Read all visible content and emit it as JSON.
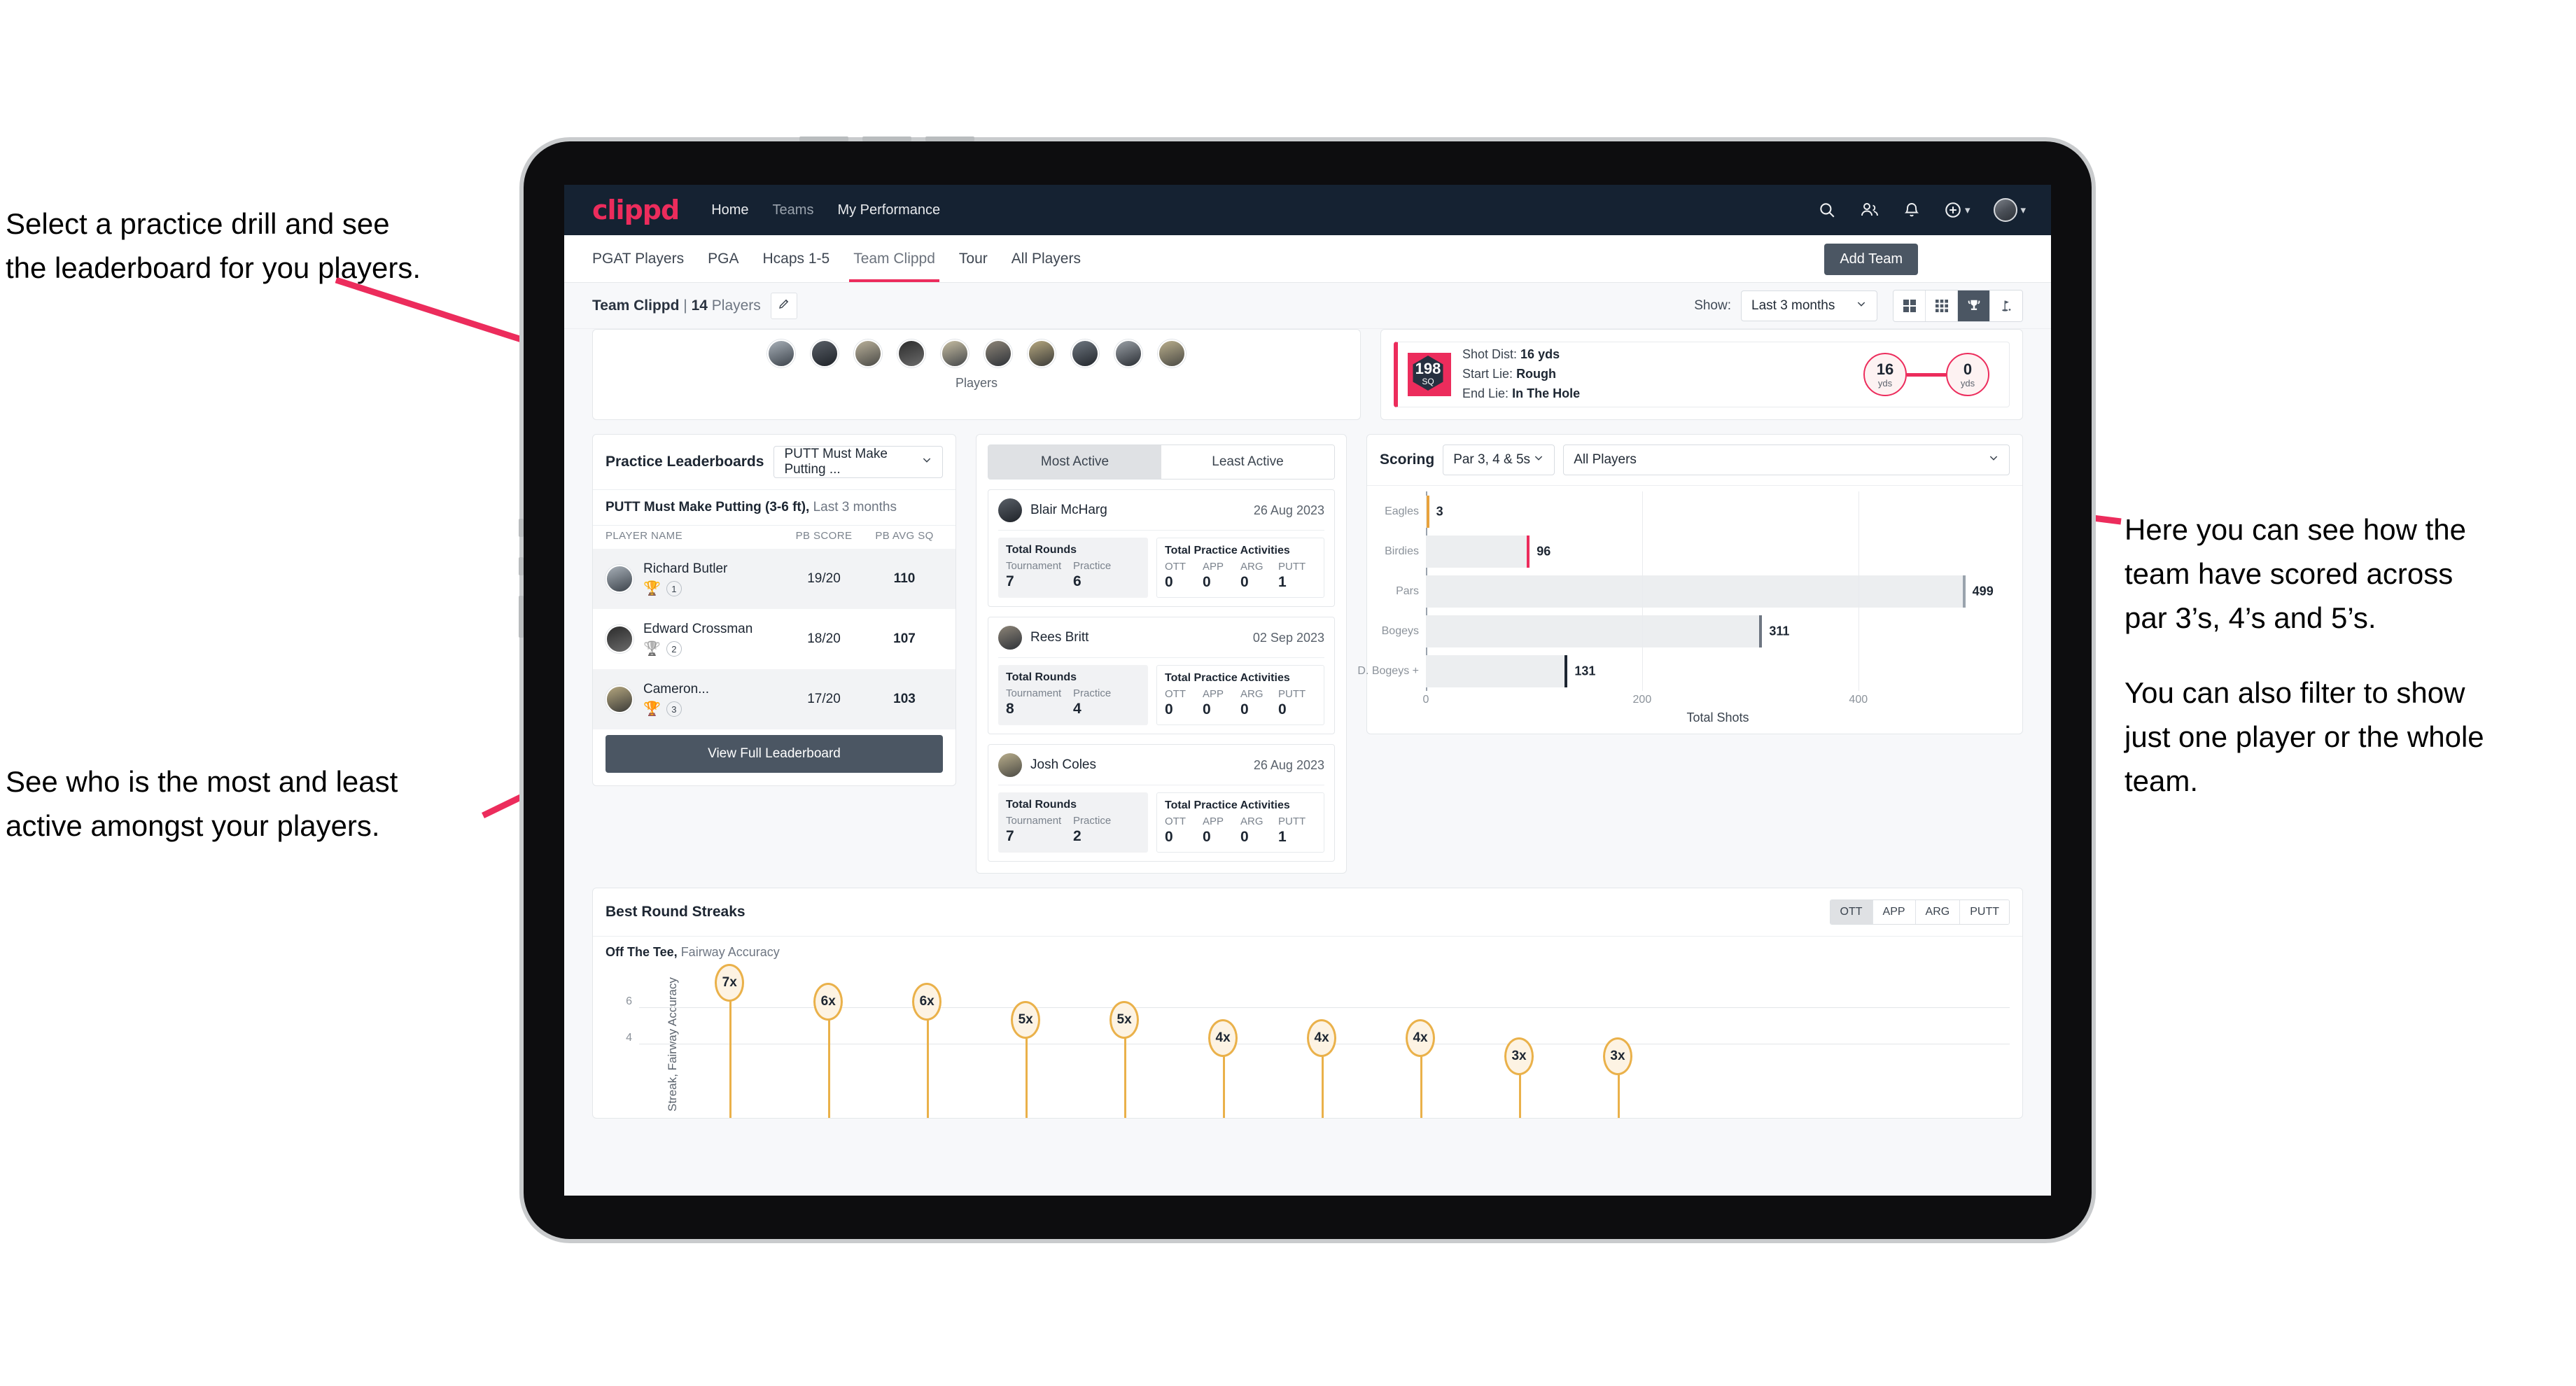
{
  "annotations": {
    "top_left": [
      "Select a practice drill and see",
      "the leaderboard for you players."
    ],
    "bottom_left": [
      "See who is the most and least",
      "active amongst your players."
    ],
    "right_p1": [
      "Here you can see how the",
      "team have scored across",
      "par 3’s, 4’s and 5’s."
    ],
    "right_p2": [
      "You can also filter to show",
      "just one player or the whole",
      "team."
    ]
  },
  "app": {
    "logo": "clippd",
    "nav": [
      {
        "label": "Home",
        "active": true
      },
      {
        "label": "Teams",
        "active": false
      },
      {
        "label": "My Performance",
        "active": true
      }
    ],
    "icons": [
      "search-icon",
      "people-icon",
      "bell-icon",
      "plus-circle-icon",
      "avatar"
    ],
    "tabs": [
      {
        "label": "PGAT Players",
        "active": false
      },
      {
        "label": "PGA",
        "active": false
      },
      {
        "label": "Hcaps 1-5",
        "active": false
      },
      {
        "label": "Team Clippd",
        "active": true
      },
      {
        "label": "Tour",
        "active": false
      },
      {
        "label": "All Players",
        "active": false
      }
    ],
    "add_team_label": "Add Team"
  },
  "subbar": {
    "team_name": "Team Clippd",
    "separator": " | ",
    "player_count": "14",
    "players_word": " Players",
    "edit_icon": "pencil-icon",
    "show_label": "Show:",
    "period_value": "Last 3 months",
    "view_toggles": [
      {
        "icon": "grid-large-icon",
        "active": false
      },
      {
        "icon": "grid-small-icon",
        "active": false
      },
      {
        "icon": "trophy-icon",
        "active": true
      },
      {
        "icon": "golf-flag-icon",
        "active": false
      }
    ]
  },
  "players_strip": {
    "label": "Players",
    "count": 10
  },
  "shot_card": {
    "sq_value": "198",
    "sq_unit": "SQ",
    "lines": [
      {
        "label": "Shot Dist:",
        "value": "16 yds"
      },
      {
        "label": "Start Lie:",
        "value": "Rough"
      },
      {
        "label": "End Lie:",
        "value": "In The Hole"
      }
    ],
    "start_bubble": {
      "value": "16",
      "unit": "yds"
    },
    "end_bubble": {
      "value": "0",
      "unit": "yds"
    }
  },
  "leaderboard": {
    "title": "Practice Leaderboards",
    "drill_select": "PUTT Must Make Putting ...",
    "drill_heading": "PUTT Must Make Putting (3-6 ft),",
    "drill_period": "Last 3 months",
    "columns": [
      "PLAYER NAME",
      "PB SCORE",
      "PB AVG SQ"
    ],
    "rows": [
      {
        "name": "Richard Butler",
        "rank": "1",
        "trophy": "gold",
        "pb_score": "19/20",
        "pb_avg_sq": "110"
      },
      {
        "name": "Edward Crossman",
        "rank": "2",
        "trophy": "silver",
        "pb_score": "18/20",
        "pb_avg_sq": "107"
      },
      {
        "name": "Cameron...",
        "rank": "3",
        "trophy": "bronze",
        "pb_score": "17/20",
        "pb_avg_sq": "103"
      }
    ],
    "view_full_label": "View Full Leaderboard"
  },
  "activity": {
    "tabs": [
      {
        "label": "Most Active",
        "active": true
      },
      {
        "label": "Least Active",
        "active": false
      }
    ],
    "rounds_title": "Total Rounds",
    "rounds_cols": [
      "Tournament",
      "Practice"
    ],
    "practice_title": "Total Practice Activities",
    "practice_cols": [
      "OTT",
      "APP",
      "ARG",
      "PUTT"
    ],
    "items": [
      {
        "name": "Blair McHarg",
        "date": "26 Aug 2023",
        "tournament": "7",
        "practice": "6",
        "ott": "0",
        "app": "0",
        "arg": "0",
        "putt": "1"
      },
      {
        "name": "Rees Britt",
        "date": "02 Sep 2023",
        "tournament": "8",
        "practice": "4",
        "ott": "0",
        "app": "0",
        "arg": "0",
        "putt": "0"
      },
      {
        "name": "Josh Coles",
        "date": "26 Aug 2023",
        "tournament": "7",
        "practice": "2",
        "ott": "0",
        "app": "0",
        "arg": "0",
        "putt": "1"
      }
    ]
  },
  "scoring": {
    "title": "Scoring",
    "par_filter": "Par 3, 4 & 5s",
    "player_filter": "All Players"
  },
  "streaks": {
    "title": "Best Round Streaks",
    "segments": [
      {
        "label": "OTT",
        "active": true
      },
      {
        "label": "APP",
        "active": false
      },
      {
        "label": "ARG",
        "active": false
      },
      {
        "label": "PUTT",
        "active": false
      }
    ],
    "subtitle_bold": "Off The Tee,",
    "subtitle_rest": " Fairway Accuracy",
    "ylabel": "Streak, Fairway Accuracy"
  },
  "chart_data": [
    {
      "type": "bar",
      "orientation": "horizontal",
      "title": "Scoring",
      "categories": [
        "Eagles",
        "Birdies",
        "Pars",
        "Bogeys",
        "D. Bogeys +"
      ],
      "values": [
        3,
        96,
        499,
        311,
        131
      ],
      "cap_colors": [
        "#e8a33d",
        "#ec2c5c",
        "#9aa3ad",
        "#6e7682",
        "#1d2632"
      ],
      "xlabel": "Total Shots",
      "ylabel": "",
      "xticks": [
        0,
        200,
        400
      ],
      "xlim": [
        0,
        540
      ],
      "grid": true,
      "legend": "none"
    },
    {
      "type": "bar",
      "orientation": "vertical",
      "title": "Best Round Streaks",
      "subtitle": "Off The Tee, Fairway Accuracy",
      "categories": [
        "1",
        "2",
        "3",
        "4",
        "5",
        "6",
        "7",
        "8",
        "9",
        "10"
      ],
      "values": [
        7,
        6,
        6,
        5,
        5,
        4,
        4,
        4,
        3,
        3
      ],
      "labels": [
        "7x",
        "6x",
        "6x",
        "5x",
        "5x",
        "4x",
        "4x",
        "4x",
        "3x",
        "3x"
      ],
      "ylabel": "Streak, Fairway Accuracy",
      "xlabel": "",
      "yticks": [
        4,
        6
      ],
      "ylim": [
        0,
        8
      ],
      "grid": true,
      "marker": "lollipop",
      "color": "#eab14a"
    }
  ]
}
